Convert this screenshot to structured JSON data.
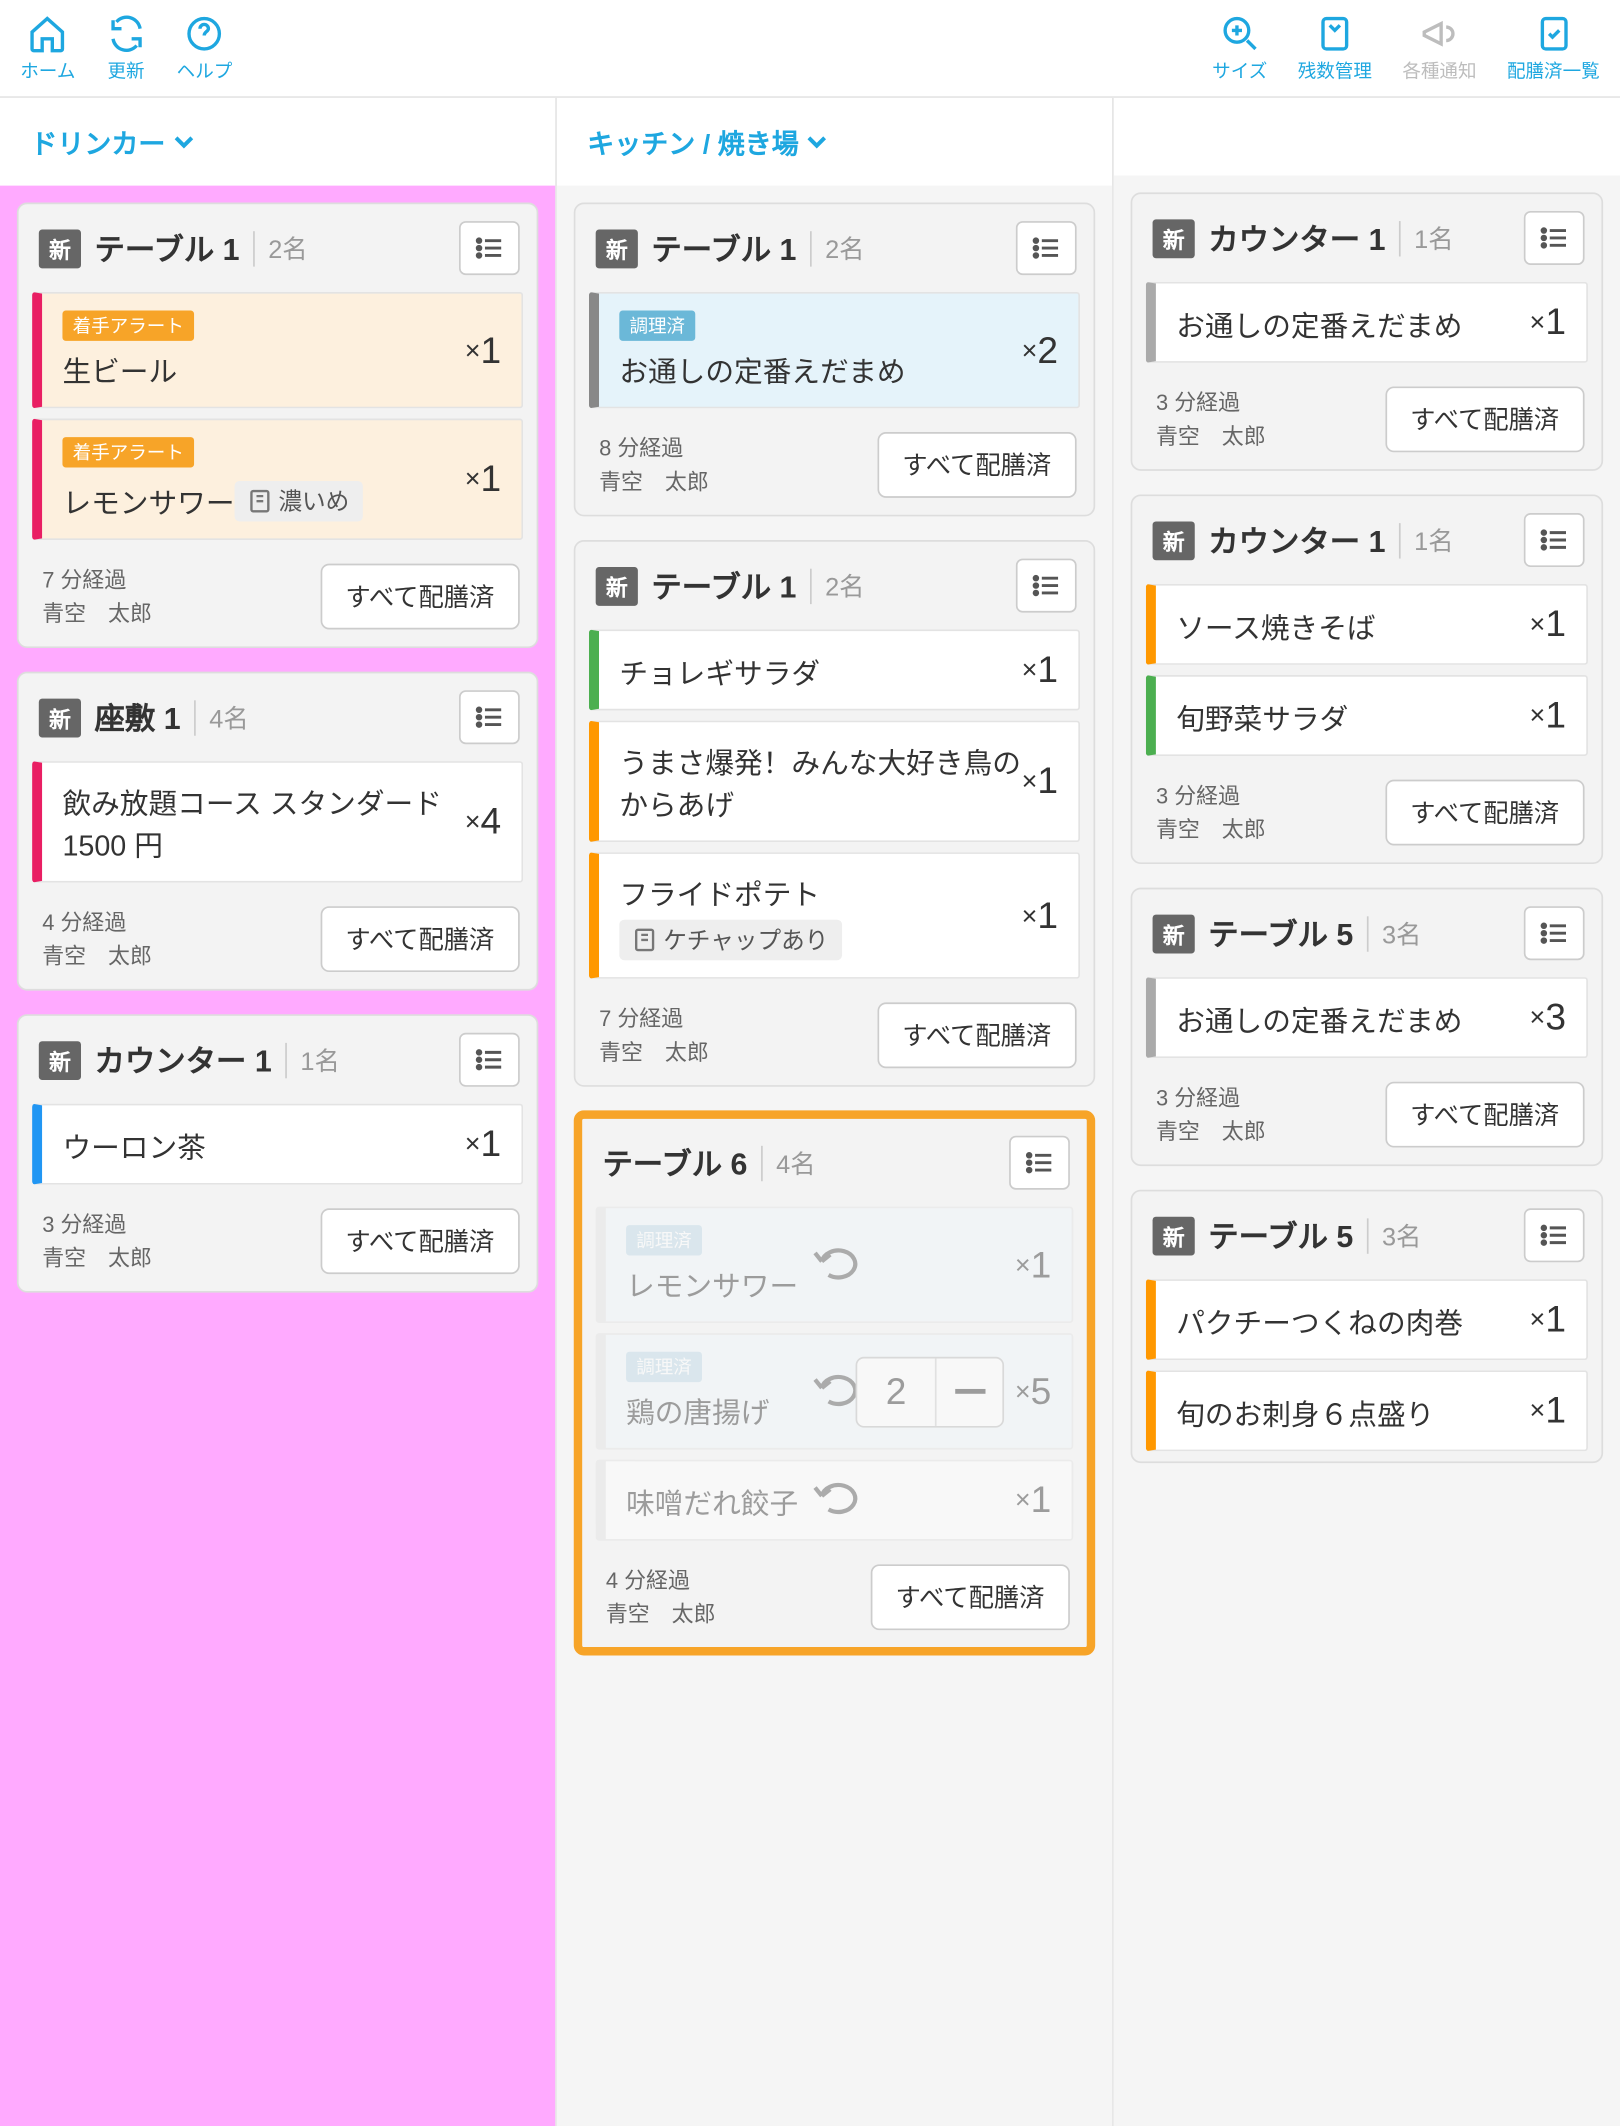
{
  "toolbar": {
    "left": [
      {
        "icon": "home",
        "label": "ホーム"
      },
      {
        "icon": "refresh",
        "label": "更新"
      },
      {
        "icon": "help",
        "label": "ヘルプ"
      }
    ],
    "right": [
      {
        "icon": "size",
        "label": "サイズ",
        "disabled": false
      },
      {
        "icon": "stock",
        "label": "残数管理",
        "disabled": false
      },
      {
        "icon": "announce",
        "label": "各種通知",
        "disabled": true
      },
      {
        "icon": "served",
        "label": "配膳済一覧",
        "disabled": false
      }
    ]
  },
  "sections": [
    {
      "title": "ドリンカー"
    },
    {
      "title": "キッチン / 焼き場"
    }
  ],
  "serve_all_label": "すべて配膳済",
  "columns": [
    {
      "cards": [
        {
          "new": true,
          "title": "テーブル 1",
          "guests": "2名",
          "items": [
            {
              "style": "alert",
              "badge": {
                "text": "着手アラート",
                "cls": "bg-orange"
              },
              "name": "生ビール",
              "qty": "1"
            },
            {
              "style": "alert",
              "badge": {
                "text": "着手アラート",
                "cls": "bg-orange"
              },
              "name": "レモンサワー",
              "sub": "濃いめ",
              "qty": "1"
            }
          ],
          "elapsed": "7 分経過",
          "staff": "青空　太郎"
        },
        {
          "new": true,
          "title": "座敷 1",
          "guests": "4名",
          "items": [
            {
              "style": "pink",
              "name": "飲み放題コース スタンダード 1500 円",
              "qty": "4"
            }
          ],
          "elapsed": "4 分経過",
          "staff": "青空　太郎"
        },
        {
          "new": true,
          "title": "カウンター 1",
          "guests": "1名",
          "items": [
            {
              "style": "bluebar",
              "name": "ウーロン茶",
              "qty": "1"
            }
          ],
          "elapsed": "3 分経過",
          "staff": "青空　太郎"
        }
      ]
    },
    {
      "cards": [
        {
          "new": true,
          "title": "テーブル 1",
          "guests": "2名",
          "items": [
            {
              "style": "blue",
              "badge": {
                "text": "調理済",
                "cls": "bg-blue"
              },
              "name": "お通しの定番えだまめ",
              "qty": "2"
            }
          ],
          "elapsed": "8 分経過",
          "staff": "青空　太郎"
        },
        {
          "new": true,
          "title": "テーブル 1",
          "guests": "2名",
          "items": [
            {
              "style": "green",
              "name": "チョレギサラダ",
              "qty": "1"
            },
            {
              "style": "orange",
              "name": "うまさ爆発！みんな大好き鳥のからあげ",
              "qty": "1"
            },
            {
              "style": "orange",
              "name": "フライドポテト",
              "sub": "ケチャップあり",
              "qty": "1"
            }
          ],
          "elapsed": "7 分経過",
          "staff": "青空　太郎"
        },
        {
          "highlight": true,
          "new": false,
          "title": "テーブル 6",
          "guests": "4名",
          "items": [
            {
              "style": "faded",
              "badge": {
                "text": "調理済",
                "cls": "bg-fblue"
              },
              "name": "レモンサワー",
              "qty": "1",
              "undo": true
            },
            {
              "style": "faded",
              "badge": {
                "text": "調理済",
                "cls": "bg-fblue"
              },
              "name": "鶏の唐揚げ",
              "qty": "5",
              "undo": true,
              "qtyctrl": "2"
            },
            {
              "style": "faded2",
              "name": "味噌だれ餃子",
              "qty": "1",
              "undo": true
            }
          ],
          "elapsed": "4 分経過",
          "staff": "青空　太郎"
        }
      ]
    },
    {
      "cards": [
        {
          "new": true,
          "title": "カウンター 1",
          "guests": "1名",
          "items": [
            {
              "style": "gray",
              "name": "お通しの定番えだまめ",
              "qty": "1"
            }
          ],
          "elapsed": "3 分経過",
          "staff": "青空　太郎"
        },
        {
          "new": true,
          "title": "カウンター 1",
          "guests": "1名",
          "items": [
            {
              "style": "orange",
              "name": "ソース焼きそば",
              "qty": "1"
            },
            {
              "style": "green",
              "name": "旬野菜サラダ",
              "qty": "1"
            }
          ],
          "elapsed": "3 分経過",
          "staff": "青空　太郎"
        },
        {
          "new": true,
          "title": "テーブル 5",
          "guests": "3名",
          "items": [
            {
              "style": "gray",
              "name": "お通しの定番えだまめ",
              "qty": "3"
            }
          ],
          "elapsed": "3 分経過",
          "staff": "青空　太郎"
        },
        {
          "new": true,
          "title": "テーブル 5",
          "guests": "3名",
          "items": [
            {
              "style": "orange",
              "name": "パクチーつくねの肉巻",
              "qty": "1"
            },
            {
              "style": "orange",
              "name": "旬のお刺身６点盛り",
              "qty": "1"
            }
          ],
          "elapsed": "",
          "staff": ""
        }
      ]
    }
  ]
}
